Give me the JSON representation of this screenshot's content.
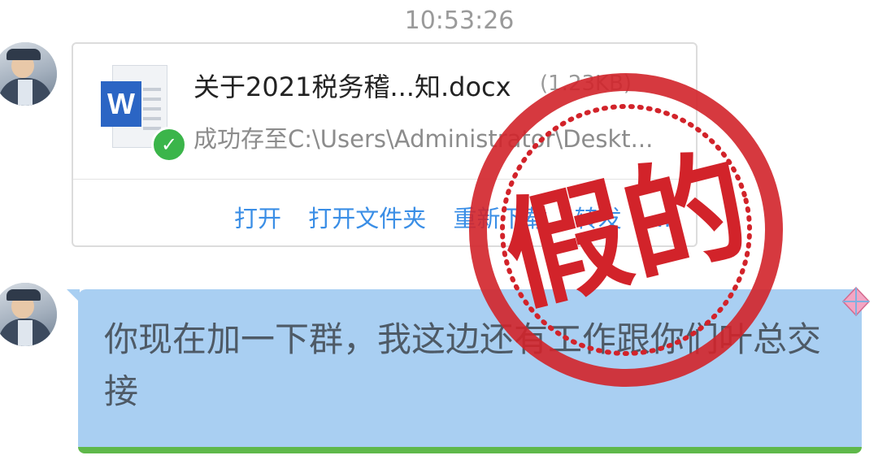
{
  "chat": {
    "timestamp": "10:53:26"
  },
  "file_message": {
    "file_name": "关于2021税务稽...知.docx",
    "file_size": "(1.23KB)",
    "status_text": "成功存至C:\\Users\\Administrator\\Deskt...",
    "actions": [
      "打开",
      "打开文件夹",
      "重新下载",
      "转发",
      "..."
    ],
    "file_type_icon": "word-document-icon",
    "status_icon": "checkmark-icon"
  },
  "text_message": {
    "text": "你现在加一下群，我这边还有工作跟你们叶总交接"
  },
  "stamp": {
    "text": "假的",
    "color": "#d2232a"
  },
  "colors": {
    "bubble": "#a9cff2",
    "link": "#3a8ee6",
    "bubble_accent": "#5fb84a"
  }
}
